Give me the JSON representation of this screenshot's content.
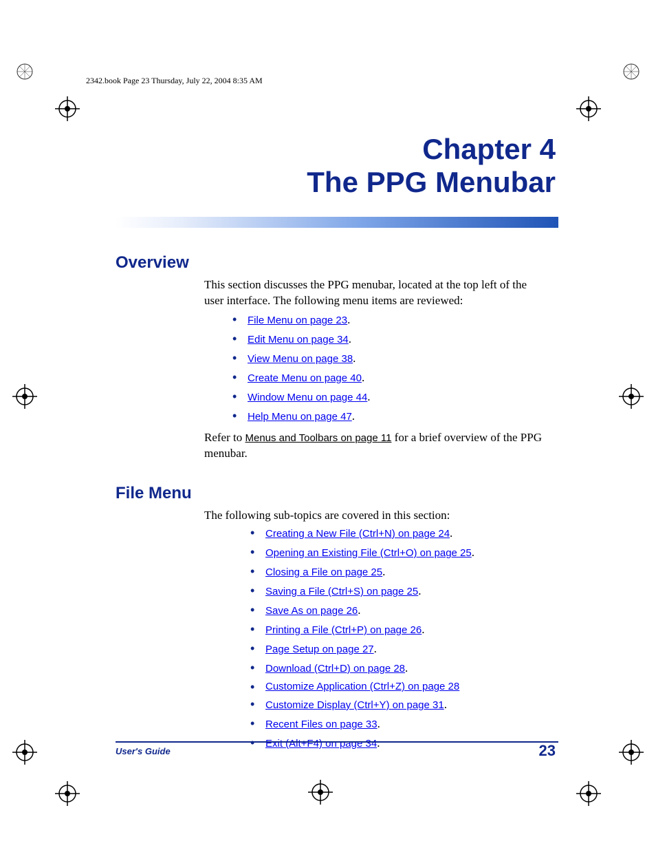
{
  "header": {
    "note": "2342.book  Page 23  Thursday, July 22, 2004  8:35 AM"
  },
  "chapter": {
    "line1": "Chapter 4",
    "line2": "The PPG Menubar"
  },
  "overview": {
    "heading": "Overview",
    "intro": "This section discusses the PPG menubar, located at the top left of the user interface. The following menu items are reviewed:",
    "items": [
      "File Menu on page 23",
      "Edit Menu on page 34",
      "View Menu on page 38",
      "Create Menu on page 40",
      "Window Menu on page 44",
      "Help Menu on page 47"
    ],
    "trailer_pre": "Refer to ",
    "trailer_link": "Menus and Toolbars on page 11",
    "trailer_post": " for a brief overview of the PPG menubar."
  },
  "file_menu": {
    "heading": "File Menu",
    "intro": "The following sub-topics are covered in this section:",
    "items": [
      "Creating a New File (Ctrl+N) on page 24",
      "Opening an Existing File (Ctrl+O) on page 25",
      "Closing a File on page 25",
      "Saving a File (Ctrl+S) on page 25",
      "Save As on page 26",
      "Printing a File (Ctrl+P) on page 26",
      "Page Setup on page 27",
      "Download (Ctrl+D) on page 28",
      "Customize Application (Ctrl+Z) on page 28",
      "Customize Display (Ctrl+Y) on page 31",
      "Recent Files on page 33",
      "Exit (Alt+F4) on page 34"
    ]
  },
  "footer": {
    "left": "User's Guide",
    "page": "23"
  }
}
